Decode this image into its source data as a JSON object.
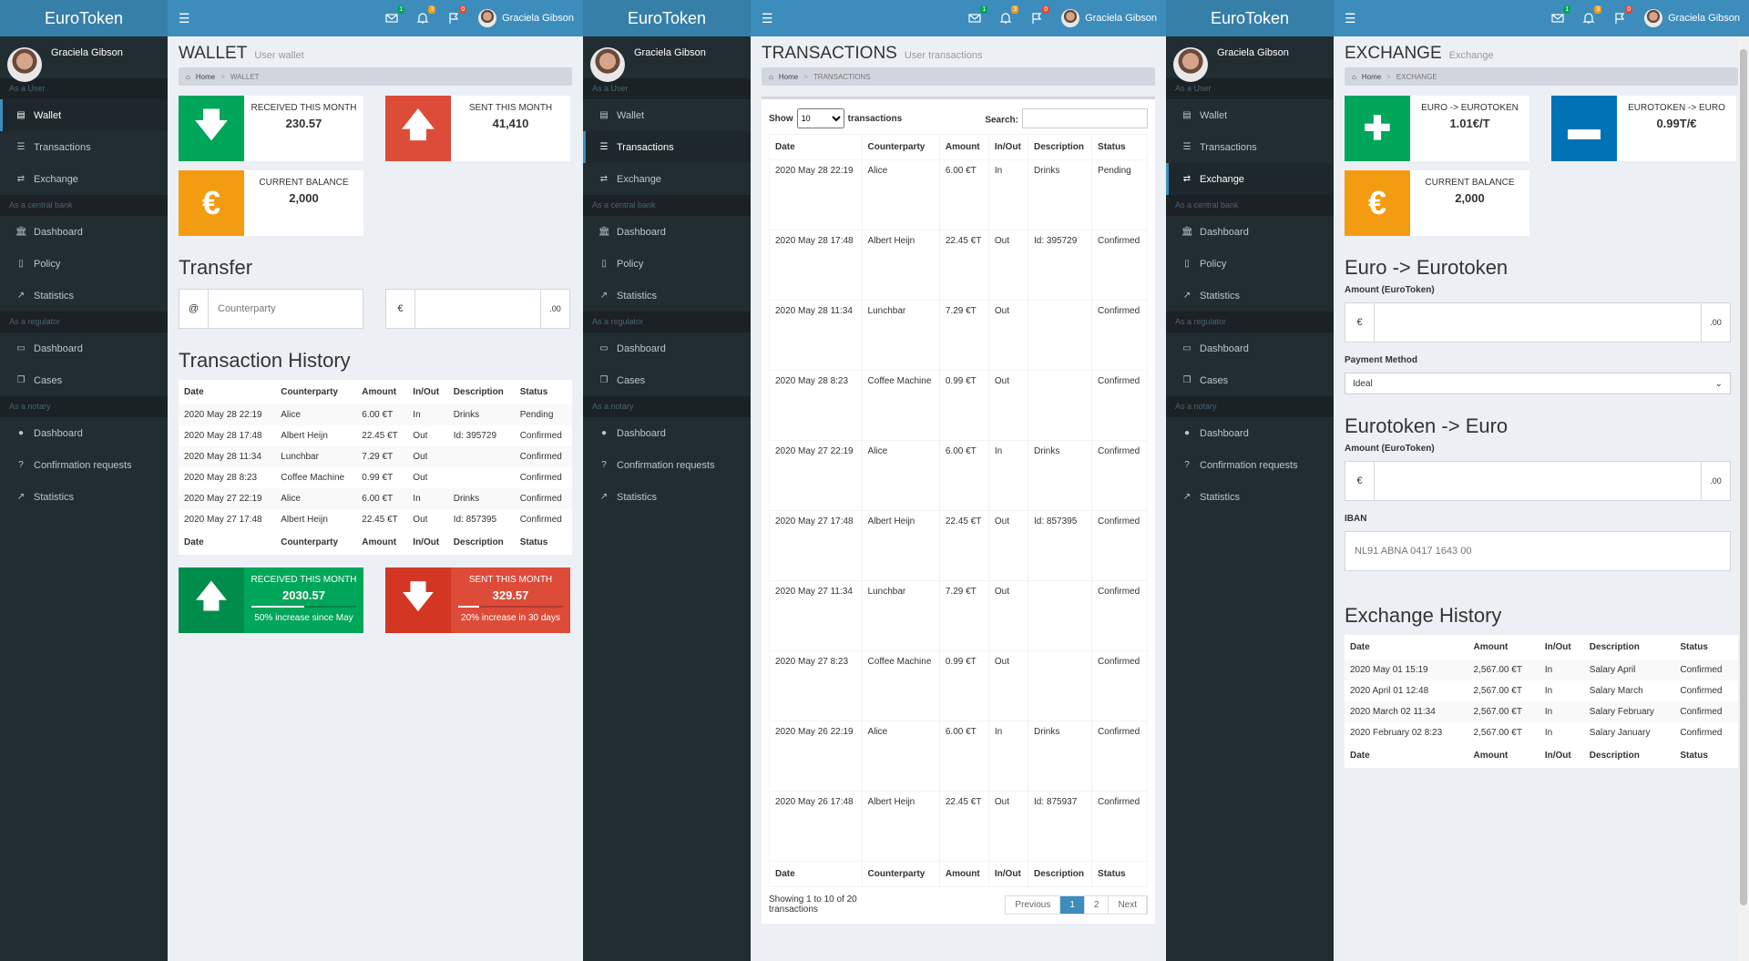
{
  "brand": "EuroToken",
  "user_name": "Graciela Gibson",
  "notif": {
    "mail": "1",
    "bell": "3",
    "flag": "0"
  },
  "sidebar": {
    "h1": "As a User",
    "h2": "As a central bank",
    "h3": "As a regulator",
    "h4": "As a notary",
    "wallet": "Wallet",
    "transactions": "Transactions",
    "exchange": "Exchange",
    "dashboard": "Dashboard",
    "policy": "Policy",
    "statistics": "Statistics",
    "cases": "Cases",
    "confirm": "Confirmation requests"
  },
  "crumb_home": "Home",
  "wallet": {
    "title": "WALLET",
    "subtitle": "User wallet",
    "crumb": "WALLET",
    "received_label": "RECEIVED THIS MONTH",
    "received_value": "230.57",
    "sent_label": "SENT THIS MONTH",
    "sent_value": "41,410",
    "balance_label": "CURRENT BALANCE",
    "balance_value": "2,000",
    "transfer_title": "Transfer",
    "counterparty_placeholder": "Counterparty",
    "at": "@",
    "euro": "€",
    "dec": ".00",
    "history_title": "Transaction History",
    "cols": [
      "Date",
      "Counterparty",
      "Amount",
      "In/Out",
      "Description",
      "Status"
    ],
    "rows": [
      [
        "2020 May 28 22:19",
        "Alice",
        "6.00 €T",
        "In",
        "Drinks",
        "Pending"
      ],
      [
        "2020 May 28 17:48",
        "Albert Heijn",
        "22.45 €T",
        "Out",
        "Id: 395729",
        "Confirmed"
      ],
      [
        "2020 May 28 11:34",
        "Lunchbar",
        "7.29 €T",
        "Out",
        "",
        "Confirmed"
      ],
      [
        "2020 May 28 8:23",
        "Coffee Machine",
        "0.99 €T",
        "Out",
        "",
        "Confirmed"
      ],
      [
        "2020 May 27 22:19",
        "Alice",
        "6.00 €T",
        "In",
        "Drinks",
        "Confirmed"
      ],
      [
        "2020 May 27 17:48",
        "Albert Heijn",
        "22.45 €T",
        "Out",
        "Id: 857395",
        "Confirmed"
      ]
    ],
    "stat1": {
      "label": "RECEIVED THIS MONTH",
      "value": "2030.57",
      "progress": 0.5,
      "desc": "50% increase since May"
    },
    "stat2": {
      "label": "SENT THIS MONTH",
      "value": "329.57",
      "progress": 0.2,
      "desc": "20% increase in 30 days"
    }
  },
  "transactions": {
    "title": "TRANSACTIONS",
    "subtitle": "User transactions",
    "crumb": "TRANSACTIONS",
    "show": "Show",
    "entries": "transactions",
    "entries_value": "10",
    "search": "Search:",
    "rows": [
      [
        "2020 May 28 22:19",
        "Alice",
        "6.00 €T",
        "In",
        "Drinks",
        "Pending"
      ],
      [
        "2020 May 28 17:48",
        "Albert Heijn",
        "22.45 €T",
        "Out",
        "Id: 395729",
        "Confirmed"
      ],
      [
        "2020 May 28 11:34",
        "Lunchbar",
        "7.29 €T",
        "Out",
        "",
        "Confirmed"
      ],
      [
        "2020 May 28 8:23",
        "Coffee Machine",
        "0.99 €T",
        "Out",
        "",
        "Confirmed"
      ],
      [
        "2020 May 27 22:19",
        "Alice",
        "6.00 €T",
        "In",
        "Drinks",
        "Confirmed"
      ],
      [
        "2020 May 27 17:48",
        "Albert Heijn",
        "22.45 €T",
        "Out",
        "Id: 857395",
        "Confirmed"
      ],
      [
        "2020 May 27 11:34",
        "Lunchbar",
        "7.29 €T",
        "Out",
        "",
        "Confirmed"
      ],
      [
        "2020 May 27 8:23",
        "Coffee Machine",
        "0.99 €T",
        "Out",
        "",
        "Confirmed"
      ],
      [
        "2020 May 26 22:19",
        "Alice",
        "6.00 €T",
        "In",
        "Drinks",
        "Confirmed"
      ],
      [
        "2020 May 26 17:48",
        "Albert Heijn",
        "22.45 €T",
        "Out",
        "Id: 875937",
        "Confirmed"
      ]
    ],
    "info": "Showing 1 to 10 of 20 transactions",
    "prev": "Previous",
    "p1": "1",
    "p2": "2",
    "next": "Next"
  },
  "exchange": {
    "title": "EXCHANGE",
    "subtitle": "Exchange",
    "crumb": "EXCHANGE",
    "rate1_label": "EURO -> EUROTOKEN",
    "rate1_value": "1.01€/T",
    "rate2_label": "EUROTOKEN -> EURO",
    "rate2_value": "0.99T/€",
    "balance_label": "CURRENT BALANCE",
    "balance_value": "2,000",
    "sec1": "Euro -> Eurotoken",
    "amount_label": "Amount (EuroToken)",
    "payment_label": "Payment Method",
    "payment_value": "Ideal",
    "sec2": "Eurotoken -> Euro",
    "amount2_label": "Amount (EuroToken)",
    "iban_label": "IBAN",
    "iban_placeholder": "NL91 ABNA 0417 1643 00",
    "history_title": "Exchange History",
    "cols": [
      "Date",
      "Amount",
      "In/Out",
      "Description",
      "Status"
    ],
    "rows": [
      [
        "2020 May 01 15:19",
        "2,567.00 €T",
        "In",
        "Salary April",
        "Confirmed"
      ],
      [
        "2020 April 01 12:48",
        "2,567.00 €T",
        "In",
        "Salary March",
        "Confirmed"
      ],
      [
        "2020 March 02 11:34",
        "2,567.00 €T",
        "In",
        "Salary February",
        "Confirmed"
      ],
      [
        "2020 February 02 8:23",
        "2,567.00 €T",
        "In",
        "Salary January",
        "Confirmed"
      ]
    ]
  }
}
